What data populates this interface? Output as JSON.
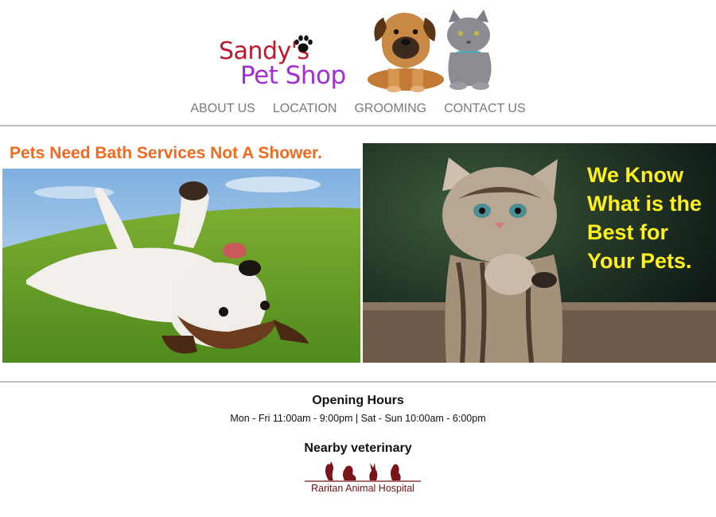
{
  "header": {
    "logo_line1": "Sandy's",
    "logo_line2": "Pet Shop",
    "logo_icon": "paw-icon",
    "pets_photo": "puppy-and-kitten-photo"
  },
  "nav": {
    "items": [
      "ABOUT US",
      "LOCATION",
      "GROOMING",
      "CONTACT US"
    ]
  },
  "banner_left": {
    "headline": "Pets Need Bath Services Not A Shower.",
    "photo": "dog-rolling-on-grass-photo"
  },
  "banner_right": {
    "caption": "We Know What is the Best for Your Pets.",
    "photo": "praying-kitten-photo"
  },
  "footer": {
    "hours_title": "Opening Hours",
    "hours_text": "Mon - Fri 11:00am - 9:00pm | Sat - Sun 10:00am - 6:00pm",
    "vet_title": "Nearby veterinary",
    "vet_name": "Raritan Animal Hospital",
    "vet_logo_icon": "animal-silhouettes-icon"
  },
  "colors": {
    "logo_red": "#c0192b",
    "logo_purple": "#a42bd6",
    "headline_orange": "#f26a1f",
    "caption_yellow": "#ffef1a",
    "nav_grey": "#7a7a7a",
    "vet_brown": "#7a1418"
  }
}
